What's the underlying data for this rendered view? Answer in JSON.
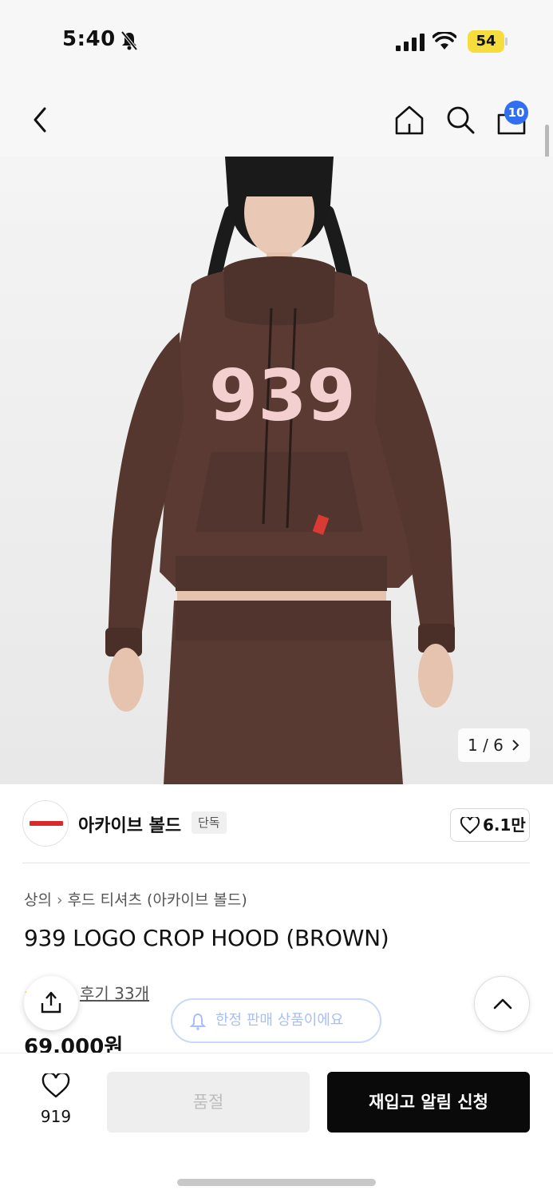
{
  "status_bar": {
    "time": "5:40",
    "battery": "54"
  },
  "nav": {
    "cart_count": "10"
  },
  "gallery": {
    "counter": "1 / 6",
    "print_text": "939"
  },
  "brand": {
    "name": "아카이브 볼드",
    "tag": "단독",
    "likes": "6.1만"
  },
  "product": {
    "breadcrumb": [
      "상의",
      "후드 티셔츠 (아카이브 볼드)"
    ],
    "title": "939 LOGO CROP HOOD (BROWN)",
    "review_label": "후기 33개",
    "price": "69,000원"
  },
  "limited_notice": "한정 판매 상품이에요",
  "bottom": {
    "wish_count": "919",
    "soldout_label": "품절",
    "restock_label": "재입고 알림 신청"
  },
  "colors": {
    "accent_blue": "#2f6ff0",
    "battery": "#f6dd3c",
    "hoodie": "#5a3a33"
  }
}
